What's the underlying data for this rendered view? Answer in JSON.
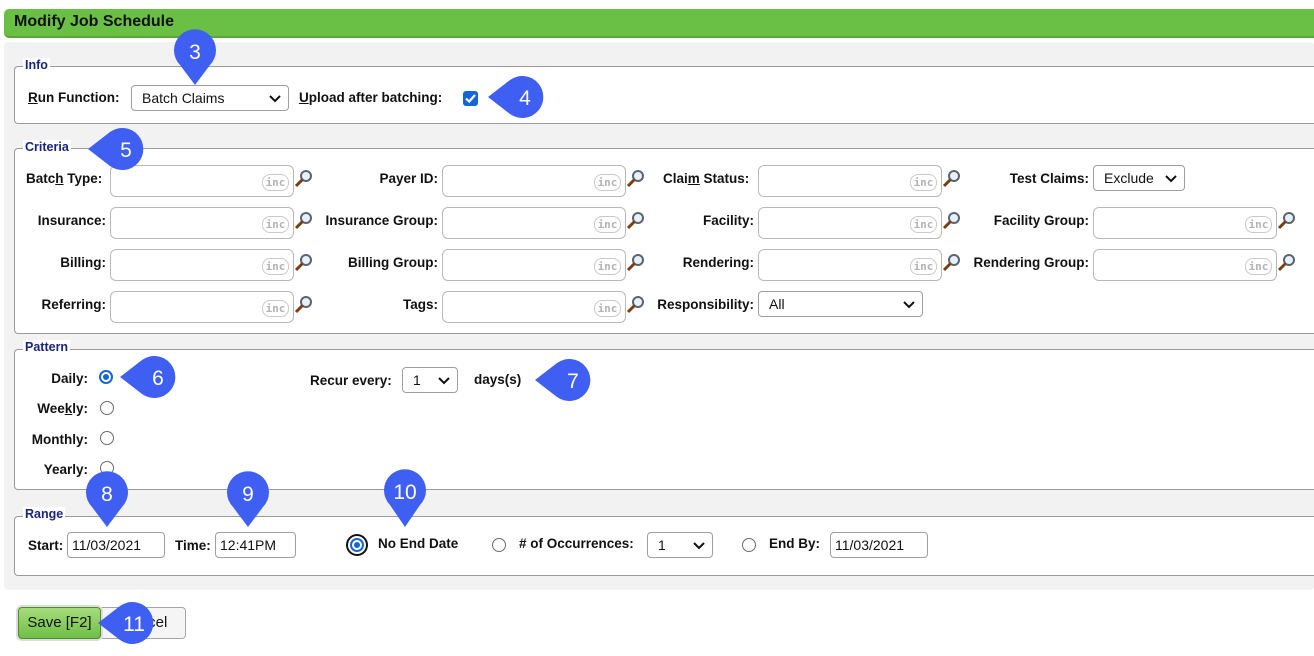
{
  "page": {
    "title": "Modify Job Schedule"
  },
  "info": {
    "legend": "Info",
    "run_function_label": "Run Function:",
    "run_function_value": "Batch Claims",
    "upload_label": "Upload after batching:",
    "upload_checked": true
  },
  "criteria": {
    "legend": "Criteria",
    "inc_text": "inc",
    "fields": [
      {
        "label": "Batch Type:"
      },
      {
        "label": "Payer ID:"
      },
      {
        "label": "Claim Status:"
      },
      {
        "label": "Insurance:"
      },
      {
        "label": "Insurance Group:"
      },
      {
        "label": "Facility:"
      },
      {
        "label": "Facility Group:"
      },
      {
        "label": "Billing:"
      },
      {
        "label": "Billing Group:"
      },
      {
        "label": "Rendering:"
      },
      {
        "label": "Rendering Group:"
      },
      {
        "label": "Referring:"
      },
      {
        "label": "Tags:"
      }
    ],
    "test_claims_label": "Test Claims:",
    "test_claims_value": "Exclude",
    "responsibility_label": "Responsibility:",
    "responsibility_value": "All"
  },
  "pattern": {
    "legend": "Pattern",
    "options": [
      "Daily:",
      "Weekly:",
      "Monthly:",
      "Yearly:"
    ],
    "selected": "Daily:",
    "recur_label": "Recur every:",
    "recur_value": "1",
    "recur_unit": "days(s)"
  },
  "range": {
    "legend": "Range",
    "start_label": "Start:",
    "start_value": "11/03/2021",
    "time_label": "Time:",
    "time_value": "12:41PM",
    "no_end_label": "No End Date",
    "occurrences_label": "# of Occurrences:",
    "occurrences_value": "1",
    "end_by_label": "End By:",
    "end_by_value": "11/03/2021",
    "selected": "No End Date"
  },
  "actions": {
    "save_label": "Save [F2]",
    "cancel_label": "Cancel"
  },
  "callouts": [
    "3",
    "4",
    "5",
    "6",
    "7",
    "8",
    "9",
    "10",
    "11"
  ],
  "colors": {
    "title_bar": "#6abf45",
    "accent": "#1565d8",
    "callout": "#3f5ff2",
    "legend": "#1a237e"
  },
  "icons": {
    "lookup": "magnifier-icon",
    "dropdown": "chevron-down-icon"
  }
}
